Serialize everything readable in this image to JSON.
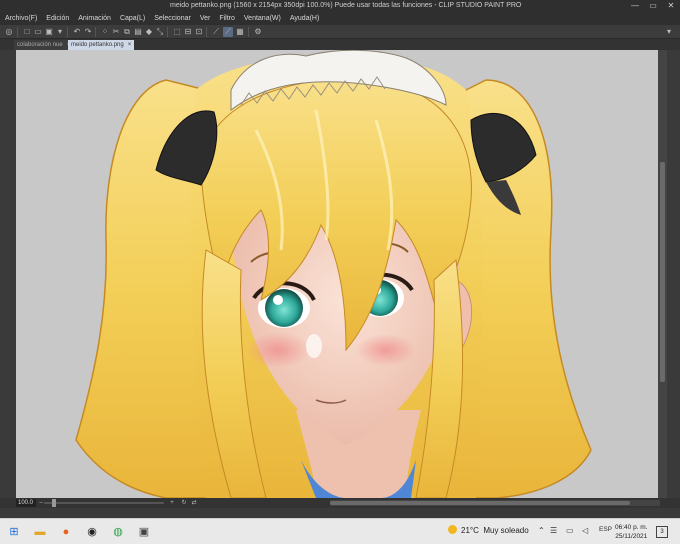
{
  "window": {
    "title": "meido pettanko.png (1560 x 2154px 350dpi 100.0%)  Puede usar todas las funciones - CLIP STUDIO PAINT PRO",
    "minimize": "—",
    "maximize": "▭",
    "close": "✕"
  },
  "menu": [
    "Archivo(F)",
    "Edición",
    "Animación",
    "Capa(L)",
    "Seleccionar",
    "Ver",
    "Filtro",
    "Ventana(W)",
    "Ayuda(H)"
  ],
  "tabs": [
    {
      "label": "colaboración nue",
      "close": "×"
    },
    {
      "label": "meido pettanko.png",
      "close": "×"
    }
  ],
  "status": {
    "zoom": "100.0"
  },
  "taskbar": {
    "weather_temp": "21°C",
    "weather_desc": "Muy soleado",
    "lang": "ESP",
    "time": "06:40 p. m.",
    "date": "25/11/2021",
    "notification_count": "3"
  },
  "colors": {
    "canvas_bg": "#c8c8c8",
    "hair": "#f3cf58",
    "skin": "#f6d6c8",
    "eyes": "#2ea89a",
    "ribbon": "#2c2c2c",
    "headdress": "#f5f3ef",
    "collar": "#4f86d6"
  }
}
